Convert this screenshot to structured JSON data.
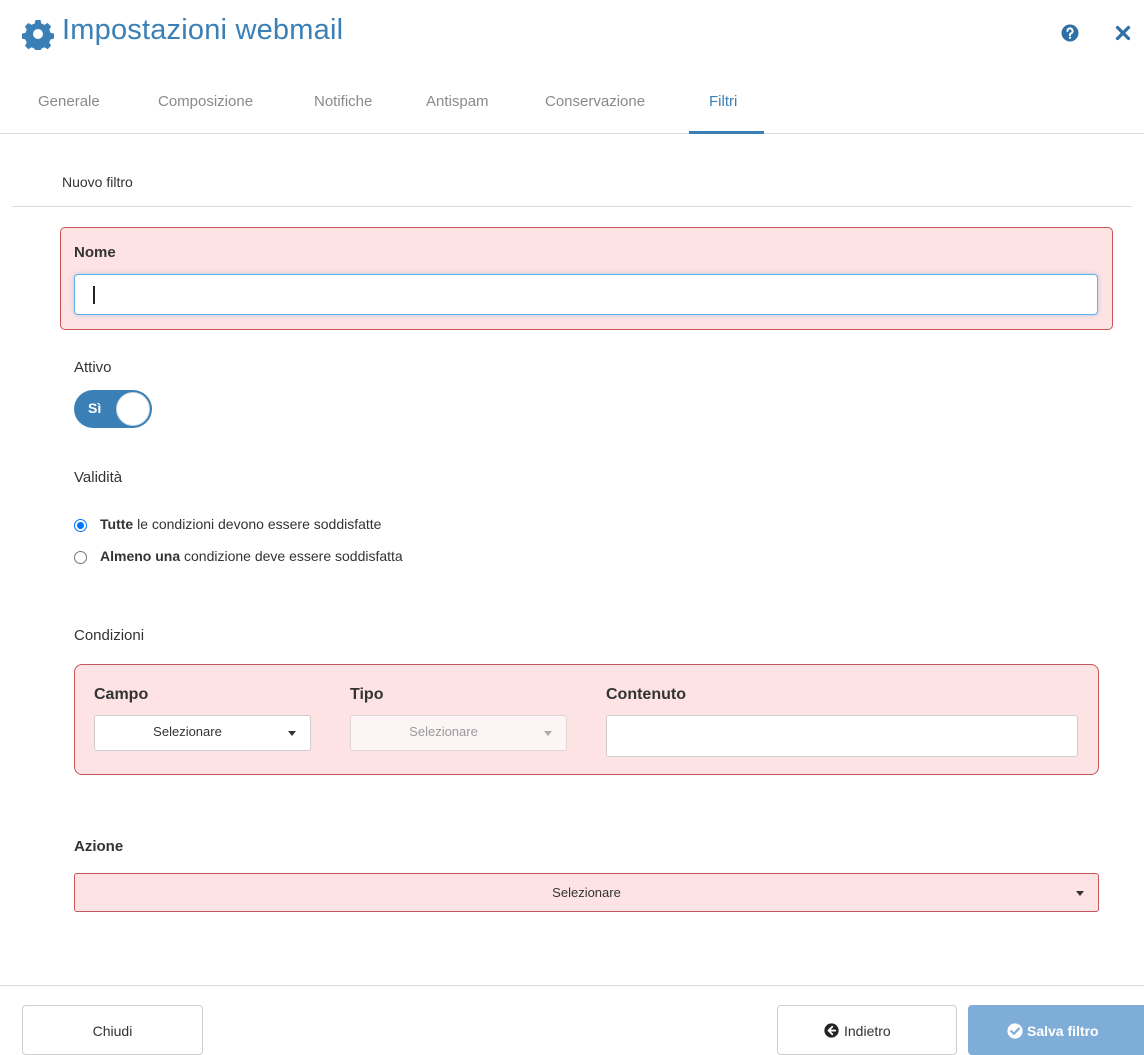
{
  "header": {
    "title": "Impostazioni webmail"
  },
  "tabs": [
    {
      "label": "Generale",
      "active": false
    },
    {
      "label": "Composizione",
      "active": false
    },
    {
      "label": "Notifiche",
      "active": false
    },
    {
      "label": "Antispam",
      "active": false
    },
    {
      "label": "Conservazione",
      "active": false
    },
    {
      "label": "Filtri",
      "active": true
    }
  ],
  "subheader": "Nuovo filtro",
  "form": {
    "name": {
      "label": "Nome",
      "value": ""
    },
    "active": {
      "label": "Attivo",
      "toggle_label": "Sì",
      "on": true
    },
    "validity": {
      "label": "Validità",
      "options": [
        {
          "bold": "Tutte",
          "rest": " le condizioni devono essere soddisfatte",
          "checked": true
        },
        {
          "bold": "Almeno una",
          "rest": " condizione deve essere soddisfatta",
          "checked": false
        }
      ]
    },
    "conditions": {
      "label": "Condizioni",
      "field": {
        "label": "Campo",
        "value": "Selezionare"
      },
      "type": {
        "label": "Tipo",
        "value": "Selezionare"
      },
      "content": {
        "label": "Contenuto",
        "value": ""
      }
    },
    "action": {
      "label": "Azione",
      "value": "Selezionare"
    }
  },
  "footer": {
    "close": "Chiudi",
    "back": "Indietro",
    "save": "Salva filtro"
  },
  "colors": {
    "accent": "#3a7fb5",
    "error_bg": "#fde3e3",
    "error_border": "#c9555a",
    "primary_button": "#7eaed8"
  },
  "icons": {
    "title": "gear-icon",
    "help": "question-circle-icon",
    "close": "close-icon",
    "back": "arrow-left-circle-icon",
    "save": "check-circle-icon"
  }
}
